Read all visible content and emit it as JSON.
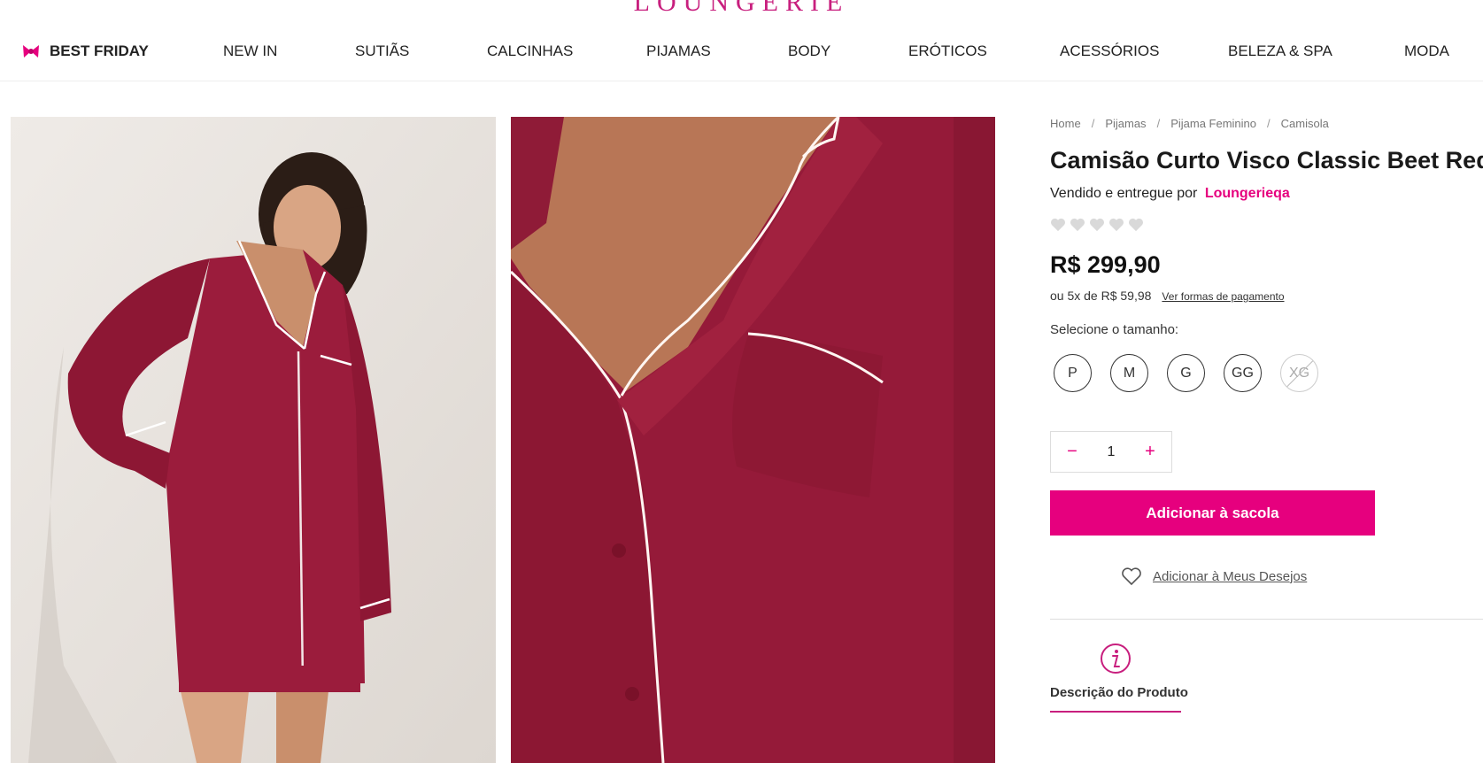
{
  "brand": {
    "logo_text": "LOUNGERIE"
  },
  "nav": {
    "items": [
      {
        "label": "BEST FRIDAY"
      },
      {
        "label": "NEW IN"
      },
      {
        "label": "SUTIÃS"
      },
      {
        "label": "CALCINHAS"
      },
      {
        "label": "PIJAMAS"
      },
      {
        "label": "BODY"
      },
      {
        "label": "ERÓTICOS"
      },
      {
        "label": "ACESSÓRIOS"
      },
      {
        "label": "BELEZA & SPA"
      },
      {
        "label": "MODA"
      }
    ]
  },
  "breadcrumb": {
    "items": [
      "Home",
      "Pijamas",
      "Pijama Feminino",
      "Camisola"
    ],
    "separator": "/"
  },
  "product": {
    "title": "Camisão Curto Visco Classic Beet Red",
    "seller_prefix": "Vendido e entregue por",
    "seller_name": "Loungerieqa",
    "rating_stars": 5,
    "rating_value": 0,
    "price": "R$ 299,90",
    "installments": "ou 5x de R$ 59,98",
    "payment_link": "Ver formas de pagamento",
    "size_label": "Selecione o tamanho:",
    "sizes": [
      {
        "label": "P",
        "available": true
      },
      {
        "label": "M",
        "available": true
      },
      {
        "label": "G",
        "available": true
      },
      {
        "label": "GG",
        "available": true
      },
      {
        "label": "XG",
        "available": false
      }
    ],
    "quantity": "1",
    "qty_minus": "−",
    "qty_plus": "+",
    "add_to_bag": "Adicionar à sacola",
    "wishlist": "Adicionar à Meus Desejos",
    "description_tab": "Descrição do Produto"
  },
  "colors": {
    "accent": "#e6007e",
    "brand": "#c81f7e",
    "garment": "#9b1c3c"
  }
}
